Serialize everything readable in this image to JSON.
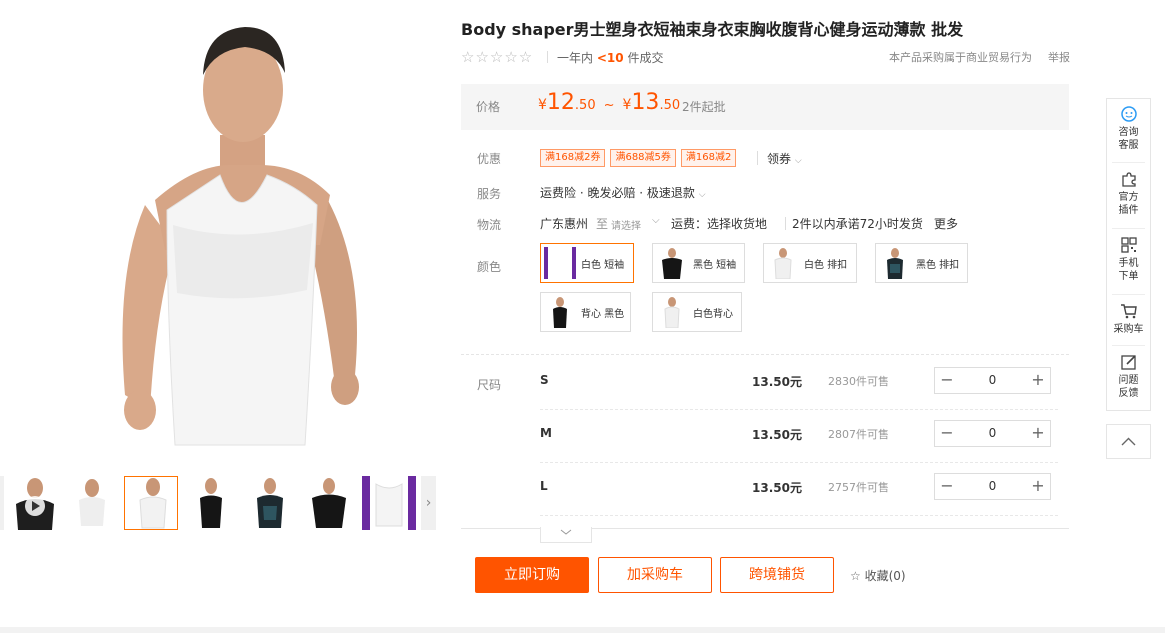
{
  "product": {
    "title": "Body shaper男士塑身衣短袖束身衣束胸收腹背心健身运动薄款 批发",
    "stars": "☆☆☆☆☆",
    "sales_prefix": "一年内",
    "sales_count": "<10",
    "sales_suffix": "件成交",
    "biz_note": "本产品采购属于商业贸易行为",
    "report": "举报"
  },
  "price": {
    "label": "价格",
    "currency": "¥",
    "low_int": "12",
    "low_dec": ".50",
    "tilde": "~",
    "high_int": "13",
    "high_dec": ".50",
    "moq": "2件起批"
  },
  "promo": {
    "label": "优惠",
    "coupons": [
      "满168减2券",
      "满688减5券",
      "满168减2"
    ],
    "get_coupon": "领券"
  },
  "service": {
    "label": "服务",
    "text": "运费险 · 晚发必赔 · 极速退款"
  },
  "logistics": {
    "label": "物流",
    "origin": "广东惠州",
    "to": "至",
    "select": "请选择",
    "freight": "运费：选择收货地",
    "promise": "2件以内承诺72小时发货",
    "more": "更多"
  },
  "colors": {
    "label": "颜色",
    "options": [
      "白色 短袖",
      "黑色 短袖",
      "白色 排扣",
      "黑色 排扣",
      "背心 黑色",
      "白色背心"
    ]
  },
  "sizes": {
    "label": "尺码",
    "rows": [
      {
        "size": "S",
        "price": "13.50元",
        "stock": "2830件可售",
        "qty": "0"
      },
      {
        "size": "M",
        "price": "13.50元",
        "stock": "2807件可售",
        "qty": "0"
      },
      {
        "size": "L",
        "price": "13.50元",
        "stock": "2757件可售",
        "qty": "0"
      }
    ],
    "minus": "−",
    "plus": "+"
  },
  "actions": {
    "buy": "立即订购",
    "cart": "加采购车",
    "crossborder": "跨境铺货",
    "fav": "收藏(0)"
  },
  "sidebar": {
    "items": [
      {
        "label1": "咨询",
        "label2": "客服",
        "icon": "chat-icon"
      },
      {
        "label1": "官方",
        "label2": "插件",
        "icon": "puzzle-icon"
      },
      {
        "label1": "手机",
        "label2": "下单",
        "icon": "qrcode-icon"
      },
      {
        "label1": "采购车",
        "label2": "",
        "icon": "cart-icon"
      },
      {
        "label1": "问题",
        "label2": "反馈",
        "icon": "edit-icon"
      }
    ]
  },
  "colors_theme": {
    "accent": "#ff5400",
    "price_bg": "#f5f5f5"
  }
}
